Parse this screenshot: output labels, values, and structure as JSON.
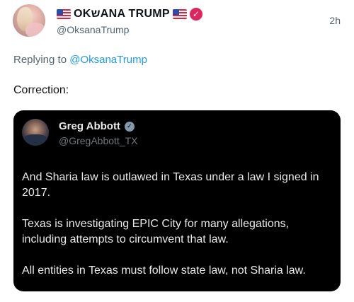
{
  "post": {
    "author": {
      "display_name": "OKשANA TRUMP",
      "handle": "@OksanaTrump",
      "verified_icon": "verified-check-icon",
      "flag_icon": "us-flag-icon"
    },
    "timestamp": "2h",
    "reply": {
      "prefix": "Replying to",
      "handle": "@OksanaTrump"
    },
    "text": "Correction:"
  },
  "quote": {
    "author": {
      "display_name": "Greg Abbott",
      "handle": "@GregAbbott_TX",
      "badge_icon": "government-badge-icon"
    },
    "paragraphs": [
      "And Sharia law is outlawed in Texas under a law I signed in 2017.",
      "Texas is investigating EPIC City for many allegations, including attempts to circumvent that law.",
      "All entities in Texas must follow state law, not Sharia law."
    ]
  },
  "colors": {
    "link": "#1d9bf0",
    "muted": "#536471",
    "verified": "#e0245e",
    "quote_bg": "#000000",
    "quote_text": "#e7e9ea"
  }
}
